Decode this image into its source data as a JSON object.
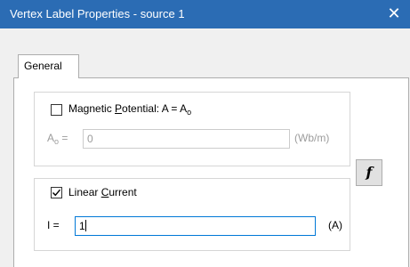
{
  "window": {
    "title": "Vertex Label Properties - source 1",
    "close_glyph": "✕"
  },
  "tabs": [
    {
      "label": "General",
      "selected": true
    }
  ],
  "magnetic": {
    "checked": false,
    "label_pre": "Magnetic ",
    "label_u": "P",
    "label_post": "otential: A = A",
    "label_sub": "o",
    "field_label_main": "A",
    "field_label_sub": "o",
    "field_label_eq": " =",
    "value": "0",
    "unit": "(Wb/m)",
    "enabled": false
  },
  "linear": {
    "checked": true,
    "label_pre": "Linear ",
    "label_u": "C",
    "label_post": "urrent",
    "field_label": "I =",
    "value": "1",
    "unit": "(A)",
    "enabled": true
  },
  "function_button": {
    "label": "f"
  }
}
